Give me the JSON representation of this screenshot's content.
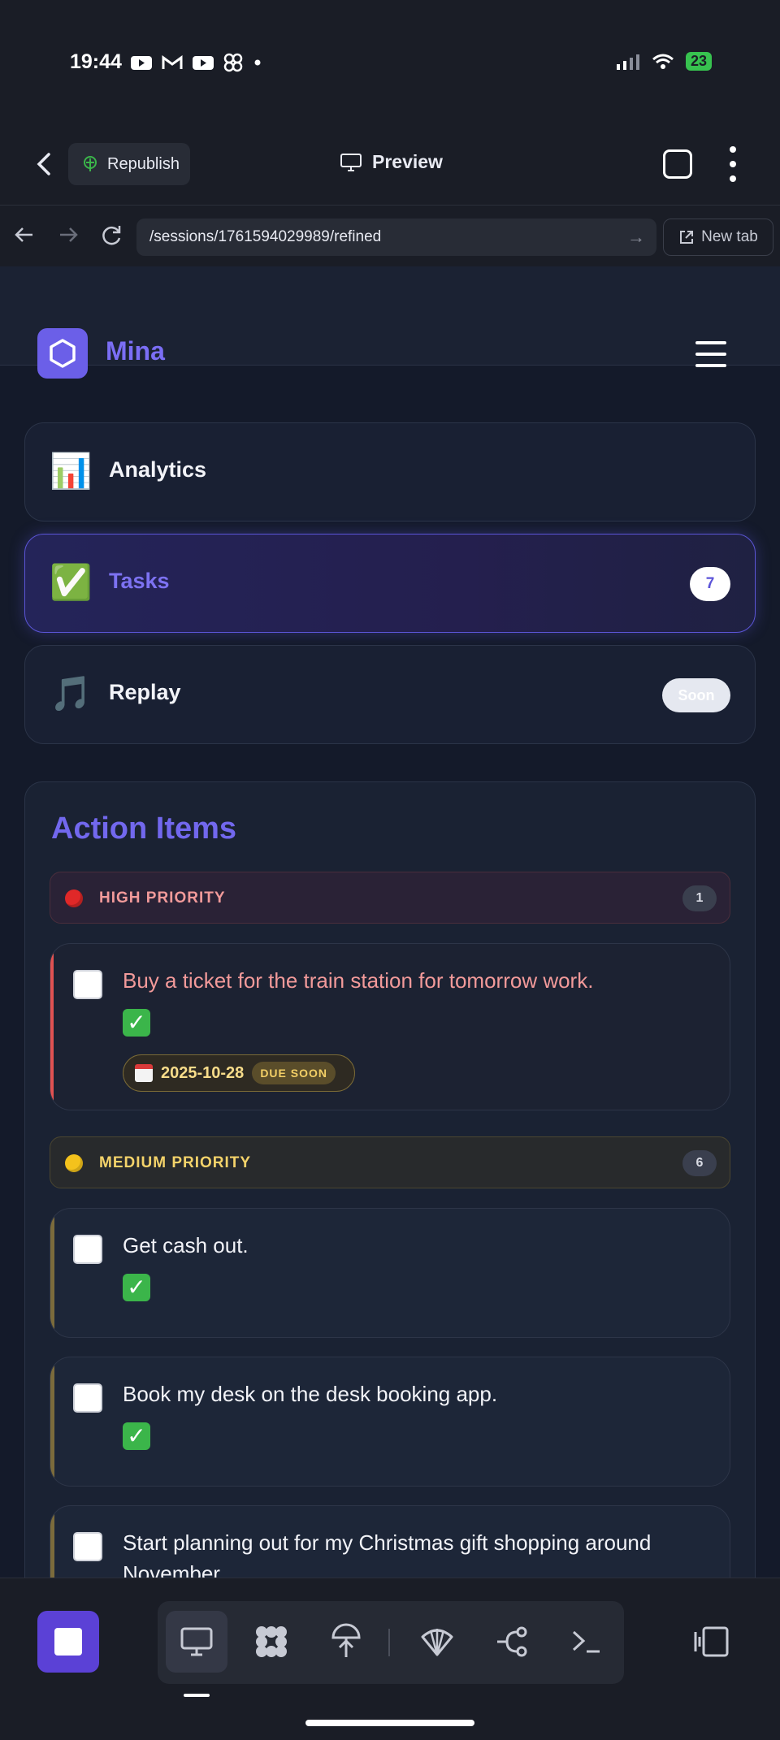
{
  "status_bar": {
    "time": "19:44",
    "battery": "23",
    "icons": [
      "youtube-icon",
      "gmail-icon",
      "youtube-icon",
      "app-icon",
      "dot-icon"
    ]
  },
  "app_header": {
    "republish_label": "Republish",
    "preview_label": "Preview"
  },
  "browser": {
    "url": "/sessions/1761594029989/refined",
    "new_tab_label": "New tab"
  },
  "page_header": {
    "brand": "Mina"
  },
  "nav_cards": [
    {
      "emoji": "📊",
      "label": "Analytics"
    },
    {
      "emoji": "✅",
      "label": "Tasks",
      "badge": "7"
    },
    {
      "emoji": "🎵",
      "label": "Replay",
      "badge": "Soon"
    }
  ],
  "action_items": {
    "title": "Action Items",
    "high": {
      "title": "HIGH PRIORITY",
      "count": "1",
      "tasks": [
        {
          "text": "Buy a ticket for the train station for tomorrow work.",
          "status": "✅",
          "due_date": "2025-10-28",
          "due_tag": "DUE SOON"
        }
      ]
    },
    "medium": {
      "title": "MEDIUM PRIORITY",
      "count": "6",
      "tasks": [
        {
          "text": "Get cash out.",
          "status": "✅"
        },
        {
          "text": "Book my desk on the desk booking app.",
          "status": "✅"
        },
        {
          "text": "Start planning out for my Christmas gift shopping around November.",
          "status": "✅"
        }
      ]
    }
  },
  "colors": {
    "accent": "#6b5fe8",
    "high_priority": "#e05252",
    "medium_priority": "#f4c21c",
    "background": "#141a2a"
  }
}
